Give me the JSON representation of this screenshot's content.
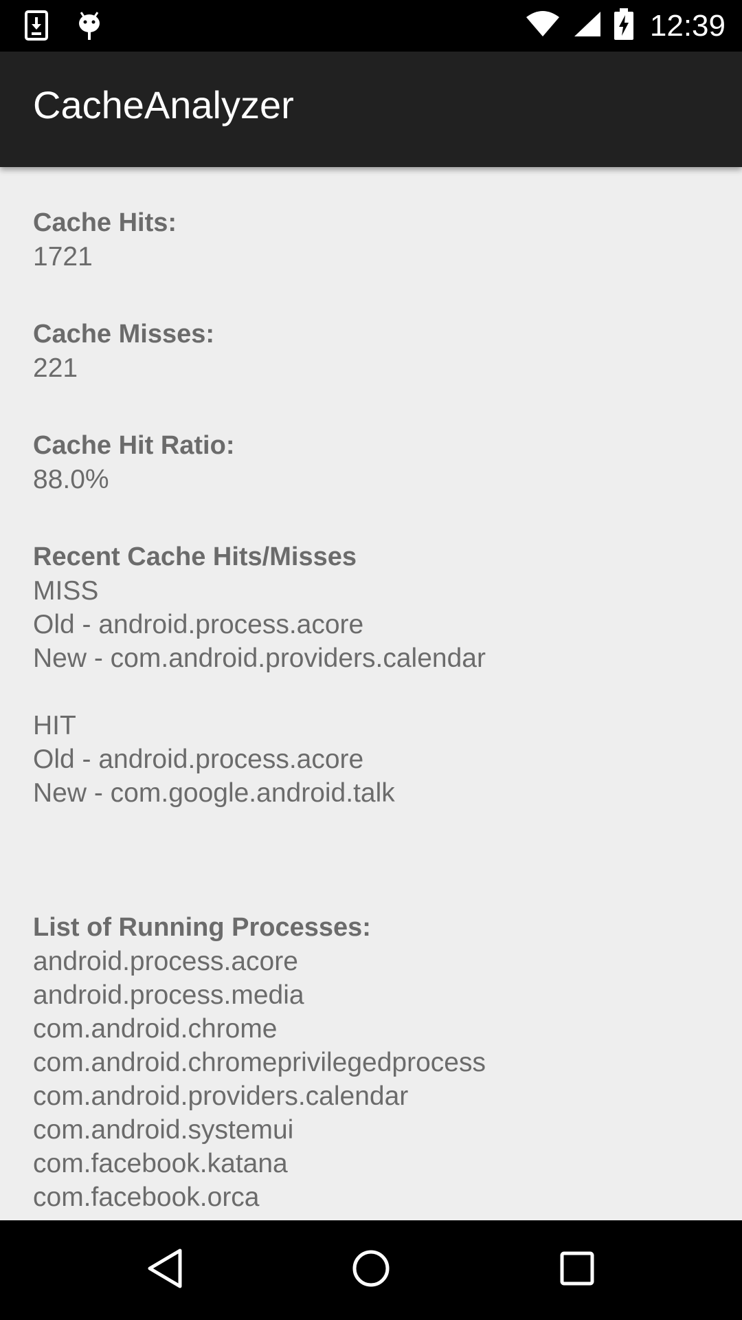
{
  "status_bar": {
    "time": "12:39",
    "left_icons": [
      "download-icon",
      "android-debug-icon"
    ],
    "right_icons": [
      "wifi-icon",
      "cell-signal-icon",
      "battery-charging-icon"
    ]
  },
  "app_bar": {
    "title": "CacheAnalyzer"
  },
  "stats": {
    "hits_label": "Cache Hits:",
    "hits_value": "1721",
    "misses_label": "Cache Misses:",
    "misses_value": "221",
    "ratio_label": "Cache Hit Ratio:",
    "ratio_value": "88.0%"
  },
  "recent": {
    "label": "Recent Cache Hits/Misses",
    "entries": [
      {
        "result": "MISS",
        "old": "Old - android.process.acore",
        "new": "New - com.android.providers.calendar"
      },
      {
        "result": "HIT",
        "old": "Old - android.process.acore",
        "new": "New - com.google.android.talk"
      }
    ]
  },
  "processes": {
    "label": "List of Running Processes:",
    "items": [
      "android.process.acore",
      "android.process.media",
      "com.android.chrome",
      "com.android.chromeprivilegedprocess",
      "com.android.providers.calendar",
      "com.android.systemui",
      "com.facebook.katana",
      "com.facebook.orca"
    ]
  },
  "nav_bar": {
    "icons": [
      "back-icon",
      "home-icon",
      "recents-icon"
    ]
  }
}
